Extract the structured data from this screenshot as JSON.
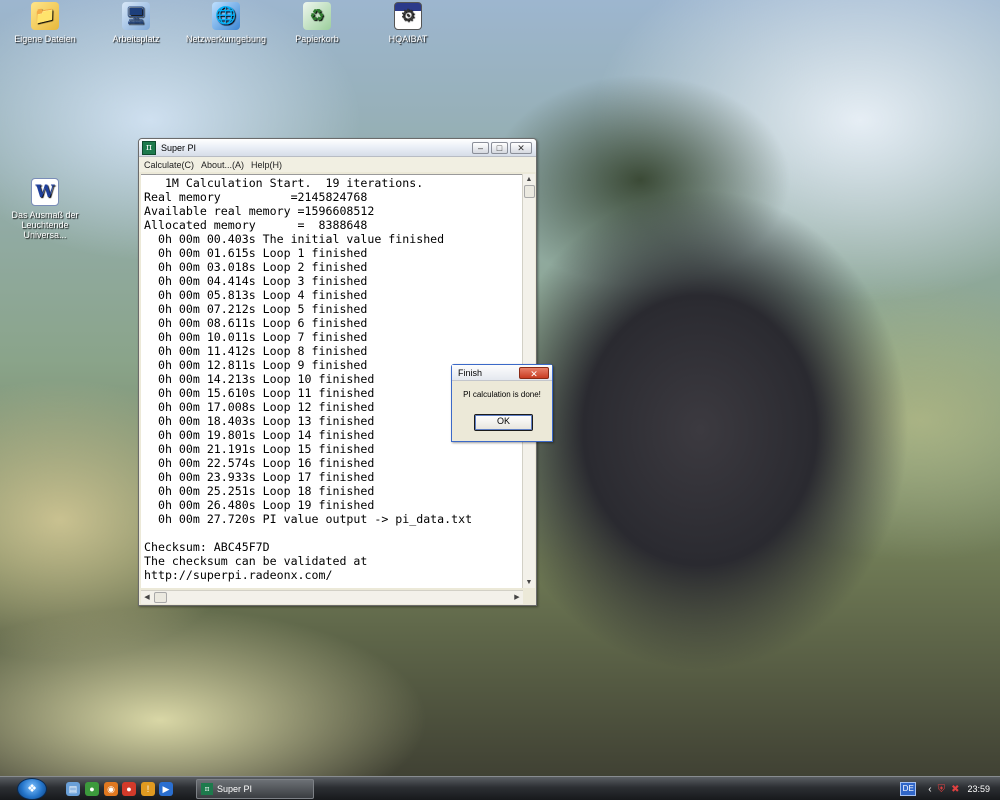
{
  "desktop": {
    "icons": [
      {
        "label": "Eigene Dateien",
        "glyph": "📁",
        "icon": "folder-icon"
      },
      {
        "label": "Arbeitsplatz",
        "glyph": "🖥",
        "icon": "computer-icon"
      },
      {
        "label": "Netzwerkumgebung",
        "glyph": "🌐",
        "icon": "network-icon"
      },
      {
        "label": "Papierkorb",
        "glyph": "♻",
        "icon": "recycle-bin-icon"
      },
      {
        "label": "HQAIBAT",
        "glyph": "⚙",
        "icon": "batch-file-icon"
      },
      {
        "label": "Das Ausmaß der Leuchtende Universa...",
        "glyph": "W",
        "icon": "word-document-icon"
      }
    ]
  },
  "superpi": {
    "title": "Super PI",
    "menu": [
      "Calculate(C)",
      "About...(A)",
      "Help(H)"
    ],
    "console_lines": [
      "   1M Calculation Start.  19 iterations.",
      "Real memory          =2145824768",
      "Available real memory =1596608512",
      "Allocated memory      =  8388648",
      "  0h 00m 00.403s The initial value finished",
      "  0h 00m 01.615s Loop 1 finished",
      "  0h 00m 03.018s Loop 2 finished",
      "  0h 00m 04.414s Loop 3 finished",
      "  0h 00m 05.813s Loop 4 finished",
      "  0h 00m 07.212s Loop 5 finished",
      "  0h 00m 08.611s Loop 6 finished",
      "  0h 00m 10.011s Loop 7 finished",
      "  0h 00m 11.412s Loop 8 finished",
      "  0h 00m 12.811s Loop 9 finished",
      "  0h 00m 14.213s Loop 10 finished",
      "  0h 00m 15.610s Loop 11 finished",
      "  0h 00m 17.008s Loop 12 finished",
      "  0h 00m 18.403s Loop 13 finished",
      "  0h 00m 19.801s Loop 14 finished",
      "  0h 00m 21.191s Loop 15 finished",
      "  0h 00m 22.574s Loop 16 finished",
      "  0h 00m 23.933s Loop 17 finished",
      "  0h 00m 25.251s Loop 18 finished",
      "  0h 00m 26.480s Loop 19 finished",
      "  0h 00m 27.720s PI value output -> pi_data.txt",
      "",
      "Checksum: ABC45F7D",
      "The checksum can be validated at",
      "http://superpi.radeonx.com/"
    ]
  },
  "dialog": {
    "title": "Finish",
    "message": "PI calculation is done!",
    "ok_label": "OK"
  },
  "taskbar": {
    "start_glyph": "❖",
    "quicklaunch": [
      {
        "glyph": "▤",
        "color": "#6aa0d8"
      },
      {
        "glyph": "●",
        "color": "#3c9a3c"
      },
      {
        "glyph": "◉",
        "color": "#e07820"
      },
      {
        "glyph": "●",
        "color": "#d23a2a"
      },
      {
        "glyph": "!",
        "color": "#e09a20"
      },
      {
        "glyph": "▶",
        "color": "#2a6fd0"
      }
    ],
    "task": {
      "label": "Super PI",
      "glyph": "π"
    },
    "tray": {
      "language": "DE",
      "clock": "23:59"
    }
  }
}
